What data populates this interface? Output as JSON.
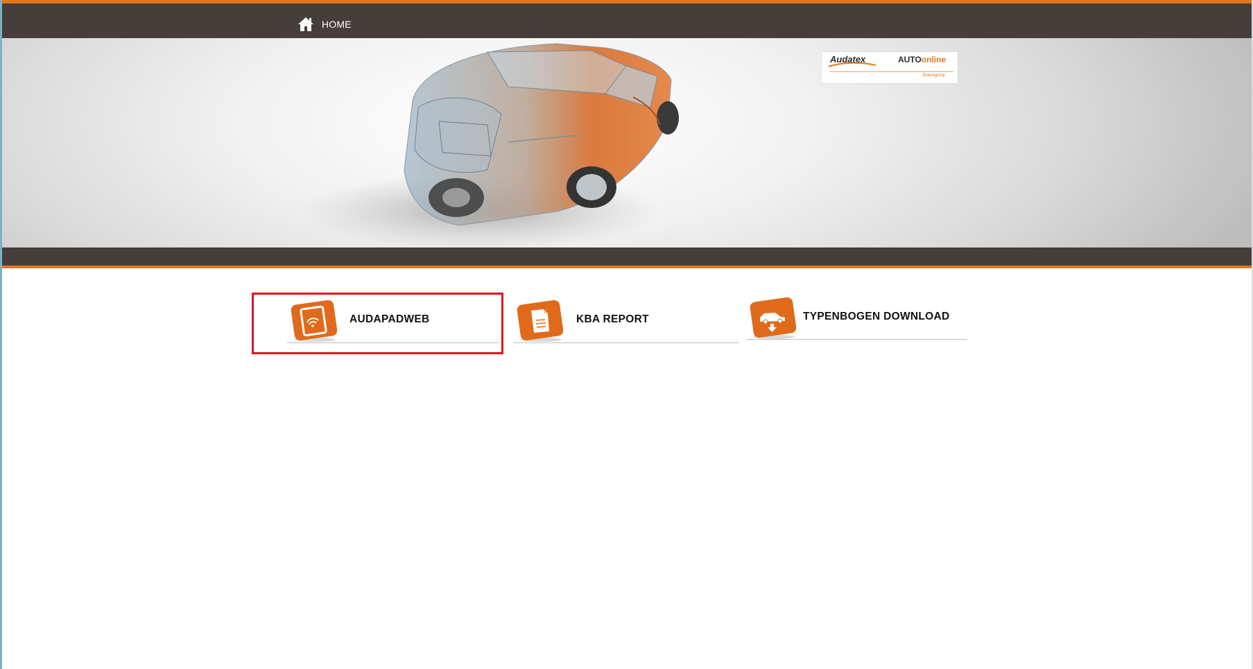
{
  "nav": {
    "home_label": "HOME",
    "home_icon": "home-icon"
  },
  "logo": {
    "audatex": "Audatex",
    "auto": "AUTO",
    "online": "online",
    "group": "Soleragroup"
  },
  "tiles": [
    {
      "label": "AUDAPADWEB",
      "icon": "tablet-wifi-icon",
      "highlighted": true
    },
    {
      "label": "KBA REPORT",
      "icon": "document-icon",
      "highlighted": false
    },
    {
      "label": "TYPENBOGEN DOWNLOAD",
      "icon": "car-download-icon",
      "highlighted": false
    }
  ],
  "colors": {
    "nav_bar": "#463e3b",
    "accent_orange": "#e2761b",
    "highlight_red": "#e3101d"
  }
}
